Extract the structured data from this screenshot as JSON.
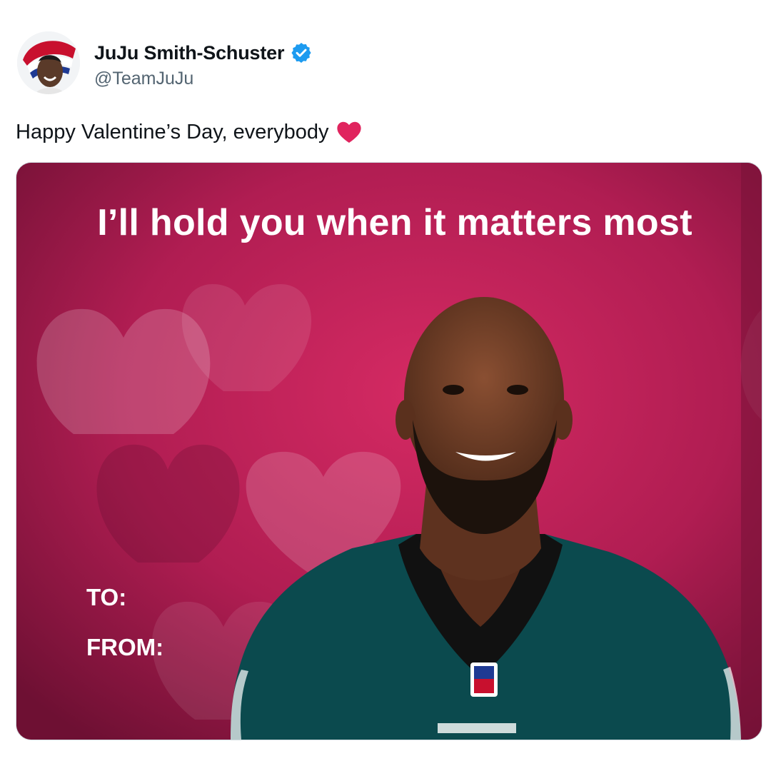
{
  "post": {
    "author": {
      "display_name": "JuJu Smith-Schuster",
      "handle": "@TeamJuJu",
      "verified": true,
      "verified_color": "#1d9bf0"
    },
    "text": "Happy Valentine’s Day, everybody",
    "text_emoji": "red-heart"
  },
  "media": {
    "caption": "I’ll hold you when it matters most",
    "to_label": "TO:",
    "from_label": "FROM:",
    "background_color": "#b01d52",
    "jersey_color": "#0b4a4e"
  }
}
